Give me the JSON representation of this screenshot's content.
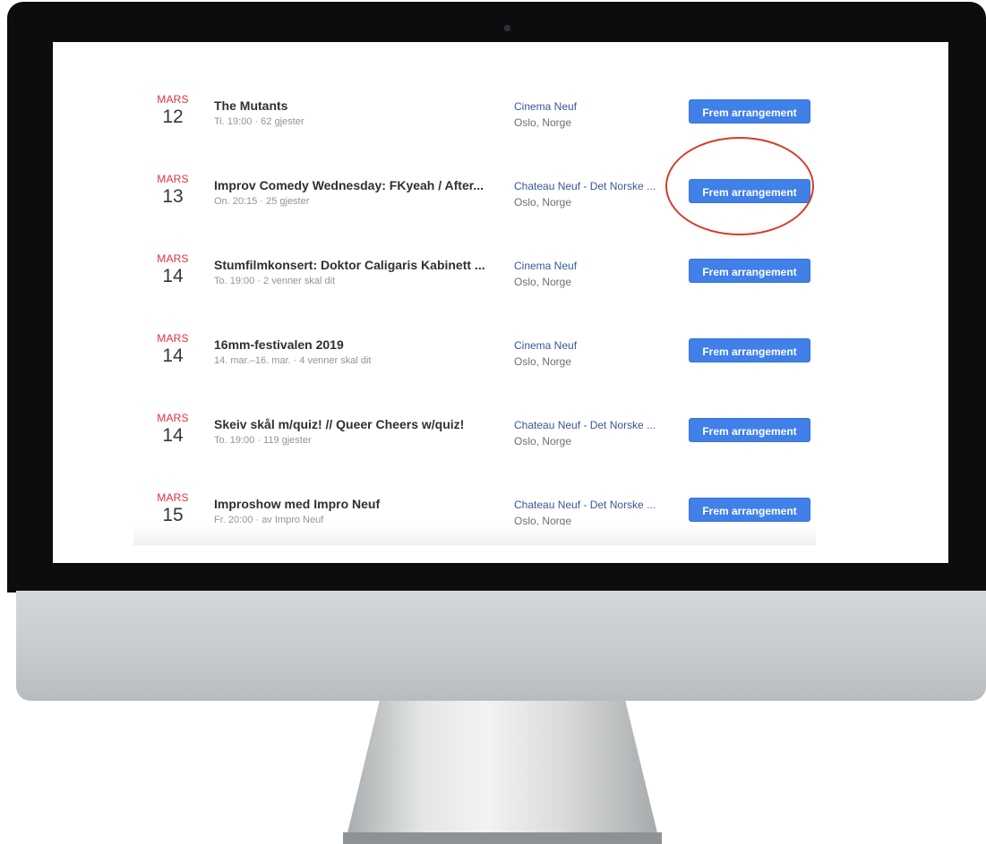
{
  "events": [
    {
      "month": "MARS",
      "day": "12",
      "title": "The Mutants",
      "meta": "Ti. 19:00 · 62 gjester",
      "venue": "Cinema Neuf",
      "city": "Oslo, Norge",
      "button": "Frem arrangement"
    },
    {
      "month": "MARS",
      "day": "13",
      "title": "Improv Comedy Wednesday: FKyeah / After...",
      "meta": "On. 20:15 · 25 gjester",
      "venue": "Chateau Neuf - Det Norske ...",
      "city": "Oslo, Norge",
      "button": "Frem arrangement"
    },
    {
      "month": "MARS",
      "day": "14",
      "title": "Stumfilmkonsert: Doktor Caligaris Kabinett ...",
      "meta": "To. 19:00 · 2 venner skal dit",
      "venue": "Cinema Neuf",
      "city": "Oslo, Norge",
      "button": "Frem arrangement"
    },
    {
      "month": "MARS",
      "day": "14",
      "title": "16mm-festivalen 2019",
      "meta": "14. mar.–16. mar. · 4 venner skal dit",
      "venue": "Cinema Neuf",
      "city": "Oslo, Norge",
      "button": "Frem arrangement"
    },
    {
      "month": "MARS",
      "day": "14",
      "title": "Skeiv skål m/quiz! // Queer Cheers w/quiz!",
      "meta": "To. 19:00 · 119 gjester",
      "venue": "Chateau Neuf - Det Norske ...",
      "city": "Oslo, Norge",
      "button": "Frem arrangement"
    },
    {
      "month": "MARS",
      "day": "15",
      "title": "Improshow med Impro Neuf",
      "meta": "Fr. 20:00 · av Impro Neuf",
      "venue": "Chateau Neuf - Det Norske ...",
      "city": "Oslo, Norge",
      "button": "Frem arrangement"
    }
  ],
  "highlight": {
    "color": "#d63a2a"
  },
  "colors": {
    "month": "#e0323a",
    "button": "#4080e8",
    "venue_link": "#365899"
  }
}
